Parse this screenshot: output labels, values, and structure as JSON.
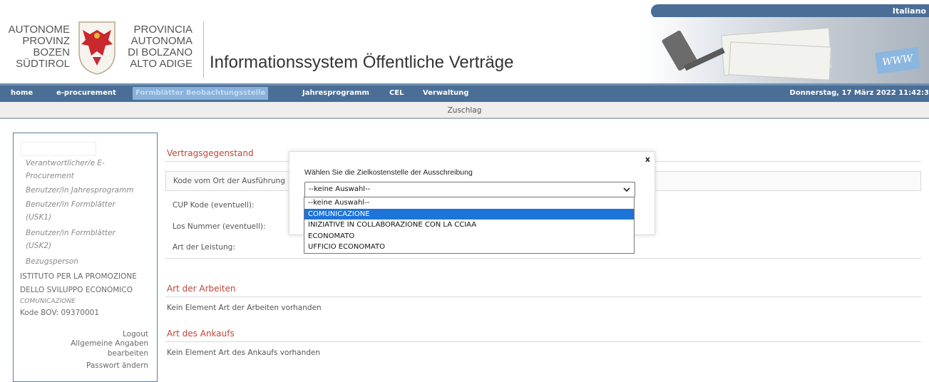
{
  "header": {
    "language_link": "Italiano",
    "logo_left_lines": [
      "AUTONOME",
      "PROVINZ",
      "BOZEN",
      "SÜDTIROL"
    ],
    "logo_right_lines": [
      "PROVINCIA",
      "AUTONOMA",
      "DI BOLZANO",
      "ALTO ADIGE"
    ],
    "site_title": "Informationssystem Öffentliche Verträge",
    "banner_www": "WWW"
  },
  "nav": {
    "items": [
      {
        "label": "home"
      },
      {
        "label": "e-procurement"
      },
      {
        "label": "Formblätter Beobachtungsstelle",
        "active": true
      },
      {
        "label": "Jahresprogramm"
      },
      {
        "label": "CEL"
      },
      {
        "label": "Verwaltung"
      }
    ],
    "datetime": "Donnerstag, 17 März 2022 11:42:3"
  },
  "page_title": "Zuschlag",
  "sidebar": {
    "roles": [
      "Verantwortlicher/e E-",
      "Procurement",
      "Benutzer/in Jahresprogramm",
      "Benutzer/in Formblätter",
      "(USK1)",
      "Benutzer/in Formblätter",
      "(USK2)",
      "Bezugsperson"
    ],
    "org_line1": "ISTITUTO PER LA PROMOZIONE",
    "org_line2": "DELLO SVILUPPO ECONOMICO",
    "cost_center": "COMUNICAZIONE",
    "code": "Kode BOV: 09370001",
    "logout": "Logout",
    "general_line1": "Allgemeine Angaben",
    "general_line2": "bearbeiten",
    "change_password": "Passwort ändern"
  },
  "main": {
    "section1_title": "Vertragsgegenstand",
    "fields": [
      "Kode vom Ort der Ausführung",
      "CUP Kode (eventuell):",
      "Los Nummer (eventuell):",
      "Art der Leistung:"
    ],
    "section2_title": "Art der Arbeiten",
    "section2_text": "Kein Element Art der Arbeiten vorhanden",
    "section3_title": "Art des Ankaufs",
    "section3_text": "Kein Element Art des Ankaufs vorhanden"
  },
  "dialog": {
    "close_label": "x",
    "label": "Wählen Sie die Zielkostenstelle der Ausschreibung",
    "selected_value": "--keine Auswahl--",
    "options": [
      "--keine Auswahl--",
      "COMUNICAZIONE",
      "INIZIATIVE IN COLLABORAZIONE CON LA CCIAA",
      "ECONOMATO",
      "UFFICIO ECONOMATO"
    ],
    "highlighted_index": 1
  },
  "colors": {
    "nav_bg": "#4a6e96",
    "section_title": "#c0443a",
    "option_highlight": "#1e74d8"
  }
}
